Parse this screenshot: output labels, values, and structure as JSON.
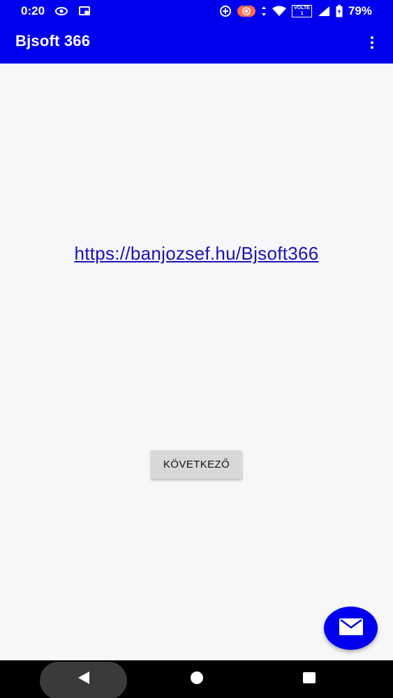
{
  "status_bar": {
    "time": "0:20",
    "volte_top": "VOLTE",
    "volte_bottom": "1",
    "battery": "79%",
    "icons": [
      "eye-icon",
      "cast-icon",
      "sync-icon",
      "record-icon",
      "data-arrows-icon",
      "wifi-icon",
      "signal-icon",
      "battery-icon"
    ]
  },
  "toolbar": {
    "title": "Bjsoft 366",
    "menu_icon": "more-vert-icon"
  },
  "content": {
    "link_text": "https://banjozsef.hu/Bjsoft366",
    "next_button_label": "KÖVETKEZŐ"
  },
  "fab": {
    "icon": "mail-icon"
  },
  "nav_bar": {
    "icons": [
      "back-icon",
      "home-icon",
      "recents-icon"
    ]
  },
  "colors": {
    "primary": "#0000ee",
    "background": "#f7f7f9",
    "link": "#1a12b8",
    "button": "#d8d8d8"
  }
}
